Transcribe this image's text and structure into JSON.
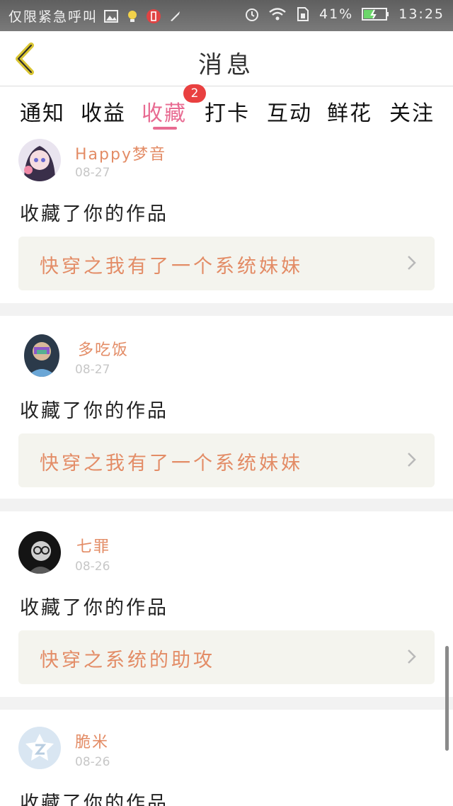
{
  "status_bar": {
    "carrier": "仅限紧急呼叫",
    "battery": "41%",
    "time": "13:25",
    "icons": [
      "image-icon",
      "bulb-icon",
      "battery-alert-icon",
      "rocket-icon",
      "alarm-icon",
      "wifi-icon",
      "sim-icon",
      "battery-icon"
    ]
  },
  "header": {
    "title": "消息",
    "back_icon": "chevron-left-icon",
    "accent": "#e7d43a"
  },
  "tabs": [
    {
      "label": "通知"
    },
    {
      "label": "收益"
    },
    {
      "label": "收藏",
      "active": true,
      "badge": "2"
    },
    {
      "label": "打卡"
    },
    {
      "label": "互动"
    },
    {
      "label": "鲜花"
    },
    {
      "label": "关注"
    }
  ],
  "messages": [
    {
      "username": "Happy梦音",
      "date": "08-27",
      "action": "收藏了你的作品",
      "work_title": "快穿之我有了一个系统妹妹"
    },
    {
      "username": "多吃饭",
      "date": "08-27",
      "action": "收藏了你的作品",
      "work_title": "快穿之我有了一个系统妹妹"
    },
    {
      "username": "七罪",
      "date": "08-26",
      "action": "收藏了你的作品",
      "work_title": "快穿之系统的助攻"
    },
    {
      "username": "脆米",
      "date": "08-26",
      "action": "收藏了你的作品"
    }
  ],
  "colors": {
    "accent_pink": "#e86b92",
    "name_orange": "#e38c66",
    "badge_red": "#e94040"
  }
}
